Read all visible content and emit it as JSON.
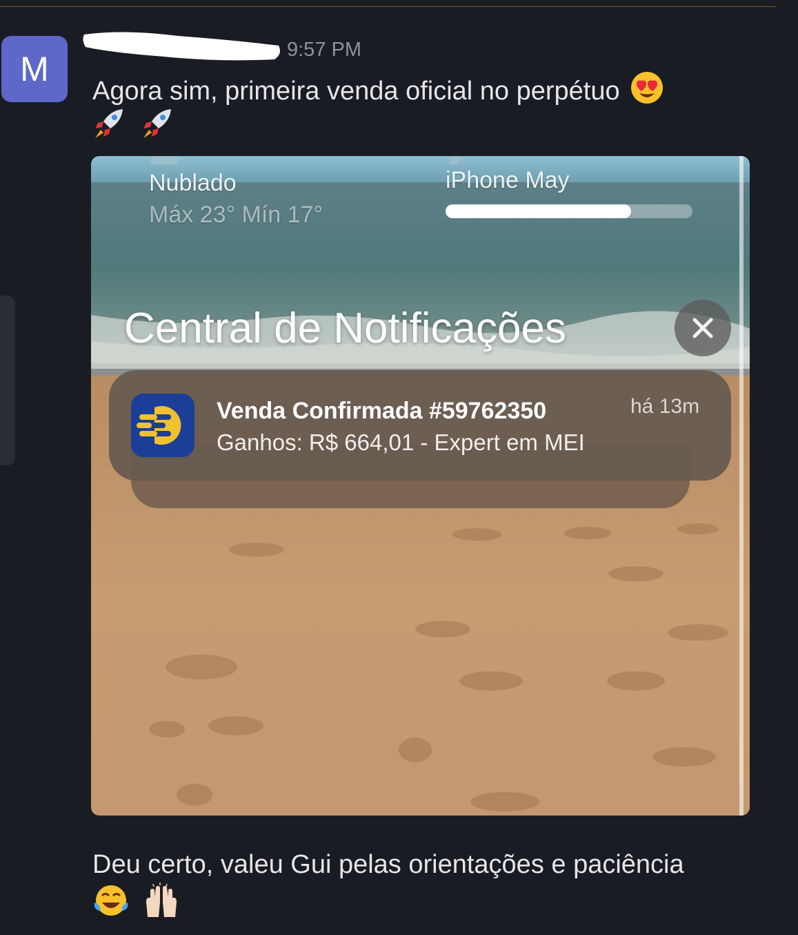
{
  "message": {
    "avatar_letter": "M",
    "timestamp": "9:57 PM",
    "text_1": "Agora sim, primeira venda oficial no perpétuo",
    "text_2": "Deu certo, valeu Gui pelas orientações e paciência",
    "emojis_1": [
      "heart-eyes",
      "rocket",
      "rocket"
    ],
    "emojis_2": [
      "tears-of-joy",
      "raised-hands"
    ]
  },
  "attachment": {
    "weather_condition": "Nublado",
    "weather_range": "Máx 23° Mín 17°",
    "device_name": "iPhone May",
    "battery_level_fraction": 0.75,
    "notification_center_title": "Central de Notificações",
    "close_icon": "close-icon",
    "notification": {
      "title": "Venda Confirmada #59762350",
      "body": "Ganhos: R$ 664,01 - Expert em MEI",
      "time": "há 13m"
    }
  },
  "colors": {
    "background": "#1a1c23",
    "avatar": "#5d68c9",
    "text": "#e6e6e8",
    "timestamp": "#8f929b",
    "app_icon_bg": "#1b3f96",
    "app_icon_fg": "#f2c12e"
  }
}
